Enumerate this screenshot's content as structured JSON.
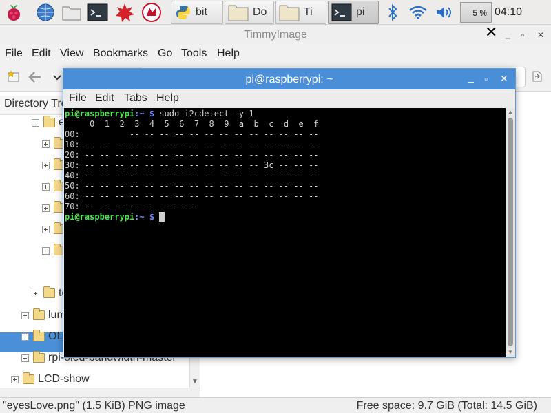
{
  "panel": {
    "tasks": [
      {
        "label": "bit",
        "icon": "python-icon"
      },
      {
        "label": "Do",
        "icon": "folder-icon"
      },
      {
        "label": "Ti",
        "icon": "folder-icon"
      },
      {
        "label": "pi",
        "icon": "terminal-icon"
      }
    ],
    "cpu": "5 %",
    "clock": "04:10"
  },
  "file_manager": {
    "title": "TimmyImage",
    "menu": [
      "File",
      "Edit",
      "View",
      "Bookmarks",
      "Go",
      "Tools",
      "Help"
    ],
    "directory_tree_label": "Directory Tre",
    "tree_items": [
      {
        "label": "e"
      },
      {
        "label": ""
      },
      {
        "label": ""
      },
      {
        "label": ""
      },
      {
        "label": ""
      },
      {
        "label": ""
      },
      {
        "label": ""
      },
      {
        "label": "te"
      },
      {
        "label": "lum"
      },
      {
        "label": "OLE"
      },
      {
        "label": "rpi-oled-bandwidth-master"
      },
      {
        "label": "LCD-show"
      }
    ],
    "status_left": "\"eyesLove.png\" (1.5 KiB) PNG image",
    "status_right": "Free space: 9.7 GiB (Total: 14.5 GiB)"
  },
  "terminal": {
    "title": "pi@raspberrypi: ~",
    "menu": [
      "File",
      "Edit",
      "Tabs",
      "Help"
    ],
    "prompt_user": "pi@raspberrypi",
    "prompt_path": ":~ $ ",
    "command": "sudo i2cdetect -y 1",
    "output": [
      "     0  1  2  3  4  5  6  7  8  9  a  b  c  d  e  f",
      "00:          -- -- -- -- -- -- -- -- -- -- -- -- --",
      "10: -- -- -- -- -- -- -- -- -- -- -- -- -- -- -- --",
      "20: -- -- -- -- -- -- -- -- -- -- -- -- -- -- -- --",
      "30: -- -- -- -- -- -- -- -- -- -- -- -- 3c -- -- --",
      "40: -- -- -- -- -- -- -- -- -- -- -- -- -- -- -- --",
      "50: -- -- -- -- -- -- -- -- -- -- -- -- -- -- -- --",
      "60: -- -- -- -- -- -- -- -- -- -- -- -- -- -- -- --",
      "70: -- -- -- -- -- -- -- --"
    ]
  },
  "colors": {
    "terminal_titlebar": "#4b8ed8",
    "selection": "#4a90d9",
    "prompt_user": "#4ee44e",
    "prompt_path": "#6f8fff"
  }
}
